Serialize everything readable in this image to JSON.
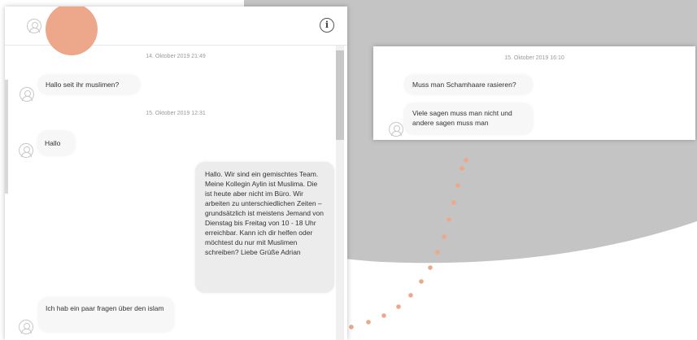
{
  "colors": {
    "accent_orange": "#eda88c",
    "background_gray": "#c4c4c4",
    "bubble_bg": "#f7f7f7",
    "own_bubble_bg": "#ececec"
  },
  "icons": {
    "avatar": "user-avatar-icon",
    "info": "info-icon"
  },
  "left_chat": {
    "info_symbol": "i",
    "messages": [
      {
        "type": "timestamp",
        "text": "14. Oktober 2019 21:49"
      },
      {
        "type": "incoming",
        "text": "Hallo seit ihr muslimen?"
      },
      {
        "type": "timestamp",
        "text": "15. Oktober 2019 12:31"
      },
      {
        "type": "incoming",
        "text": "Hallo"
      },
      {
        "type": "outgoing",
        "text": "Hallo. Wir sind ein gemischtes Team. Meine Kollegin Aylin ist Muslima. Die ist heute aber nicht im Büro. Wir arbeiten zu unterschiedlichen Zeiten – grundsätzlich ist meistens Jemand von Dienstag bis Freitag von 10 - 18 Uhr erreichbar. Kann ich dir helfen oder möchtest du nur mit Muslimen schreiben? Liebe Grüße Adrian"
      },
      {
        "type": "incoming",
        "text": "Ich hab ein paar fragen über den islam"
      }
    ]
  },
  "right_chat": {
    "messages": [
      {
        "type": "timestamp",
        "text": "15. Oktober 2019 16:10"
      },
      {
        "type": "incoming",
        "text": "Muss man Schamhaare rasieren?"
      },
      {
        "type": "incoming",
        "text": "Viele sagen muss man nicht und andere sagen muss man"
      }
    ]
  }
}
